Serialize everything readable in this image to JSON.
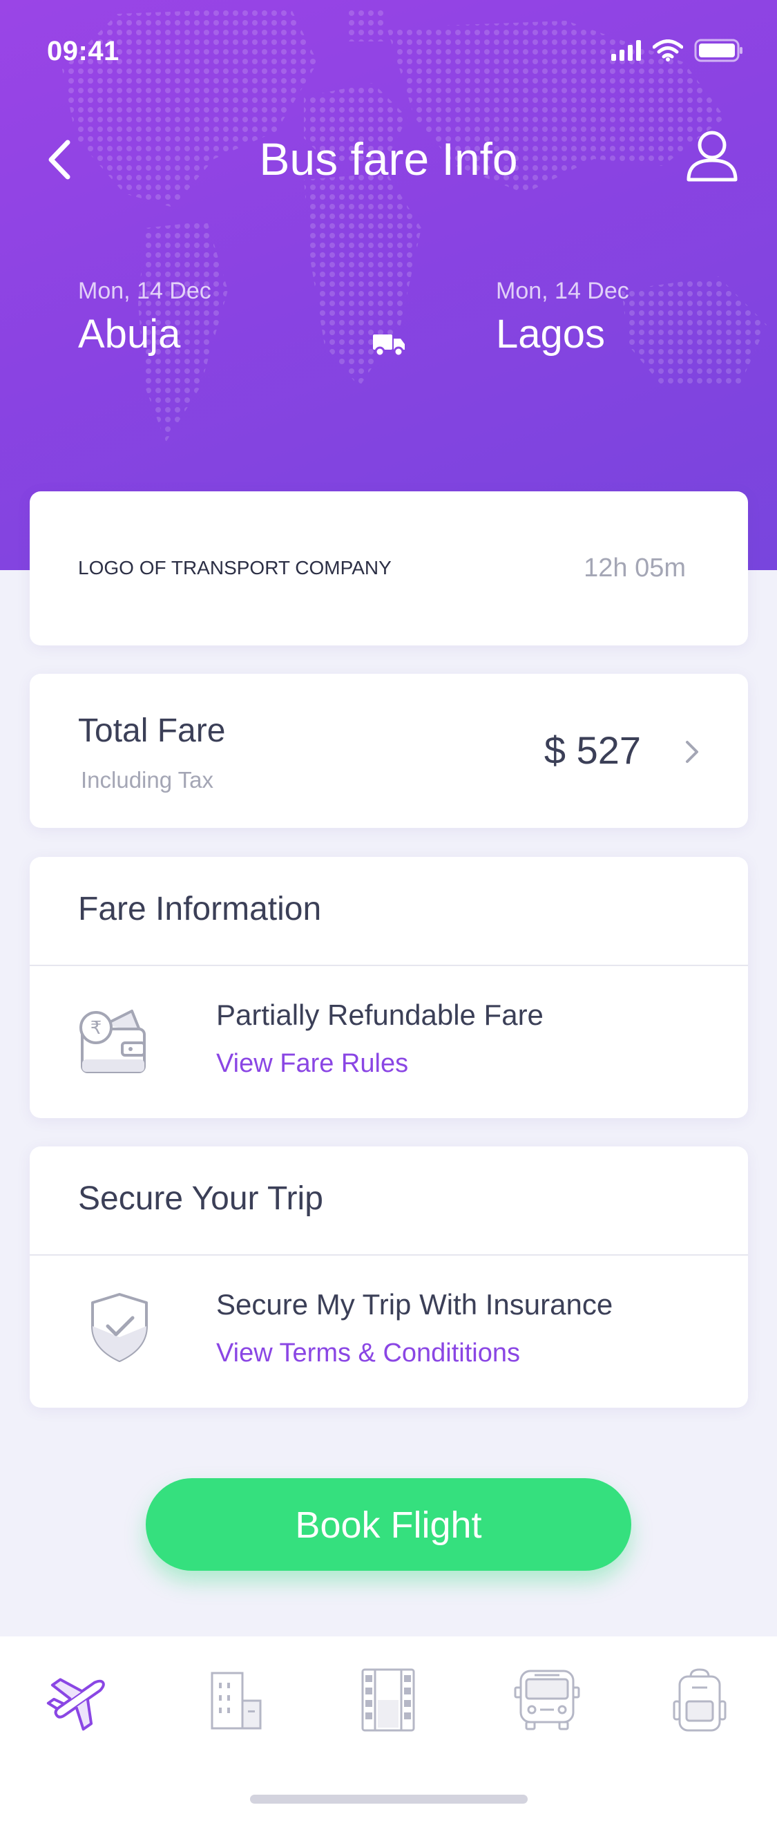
{
  "status_bar": {
    "time": "09:41"
  },
  "header": {
    "title": "Bus fare Info"
  },
  "route": {
    "origin": {
      "date": "Mon, 14 Dec",
      "city": "Abuja"
    },
    "destination": {
      "date": "Mon, 14 Dec",
      "city": "Lagos"
    }
  },
  "company_card": {
    "logo_text": "LOGO OF TRANSPORT COMPANY",
    "duration": "12h 05m"
  },
  "fare_card": {
    "label": "Total Fare",
    "sub": "Including Tax",
    "amount": "$ 527"
  },
  "fare_info": {
    "heading": "Fare Information",
    "item": "Partially Refundable Fare",
    "link": "View Fare Rules"
  },
  "secure_trip": {
    "heading": "Secure Your Trip",
    "item": "Secure My Trip With Insurance",
    "link": "View Terms & Condititions"
  },
  "book_button": {
    "label": "Book Flight"
  },
  "tabs": [
    {
      "icon": "airplane-icon",
      "active": true
    },
    {
      "icon": "hotel-icon",
      "active": false
    },
    {
      "icon": "film-icon",
      "active": false
    },
    {
      "icon": "bus-icon",
      "active": false
    },
    {
      "icon": "backpack-icon",
      "active": false
    }
  ],
  "colors": {
    "accent": "#8A46E4",
    "cta": "#35E07E",
    "background": "#F1F1FA"
  }
}
